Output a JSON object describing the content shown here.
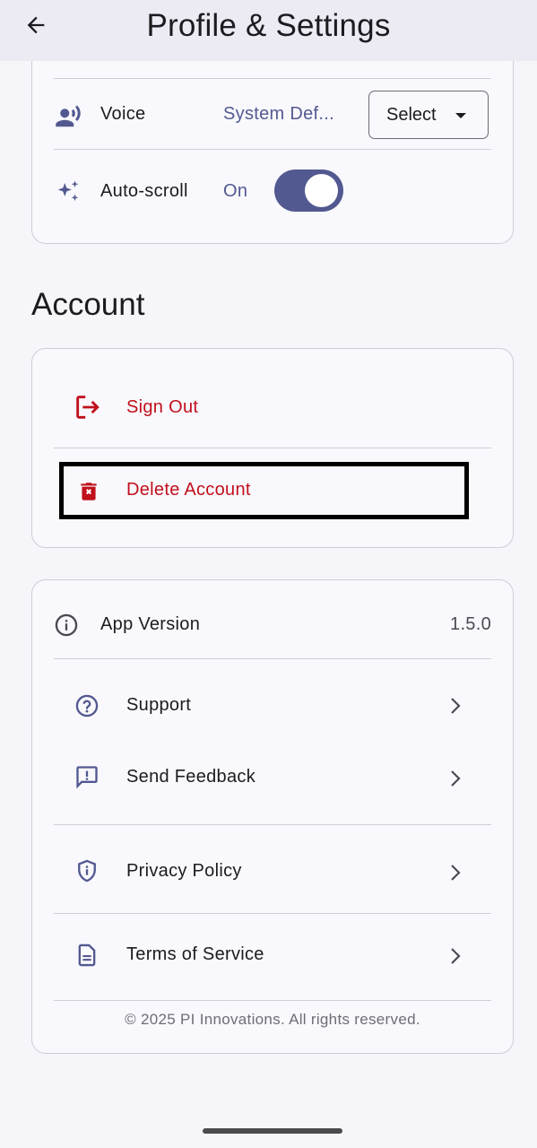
{
  "header": {
    "title": "Profile & Settings",
    "back_icon": "arrow-back-icon"
  },
  "settings": {
    "voice": {
      "label": "Voice",
      "value": "System Def...",
      "select_label": "Select",
      "icon": "voice-icon"
    },
    "autoscroll": {
      "label": "Auto-scroll",
      "state_text": "On",
      "enabled": true,
      "icon": "sparkle-icon"
    }
  },
  "account": {
    "section_title": "Account",
    "sign_out_label": "Sign Out",
    "delete_account_label": "Delete Account"
  },
  "info": {
    "app_version_label": "App Version",
    "app_version_value": "1.5.0",
    "support_label": "Support",
    "feedback_label": "Send Feedback",
    "privacy_label": "Privacy Policy",
    "terms_label": "Terms of Service",
    "copyright": "© 2025 PI Innovations. All rights reserved."
  },
  "colors": {
    "accent": "#525990",
    "danger": "#c0101c",
    "background": "#f6f5fa",
    "appbar": "#ecebf4"
  }
}
